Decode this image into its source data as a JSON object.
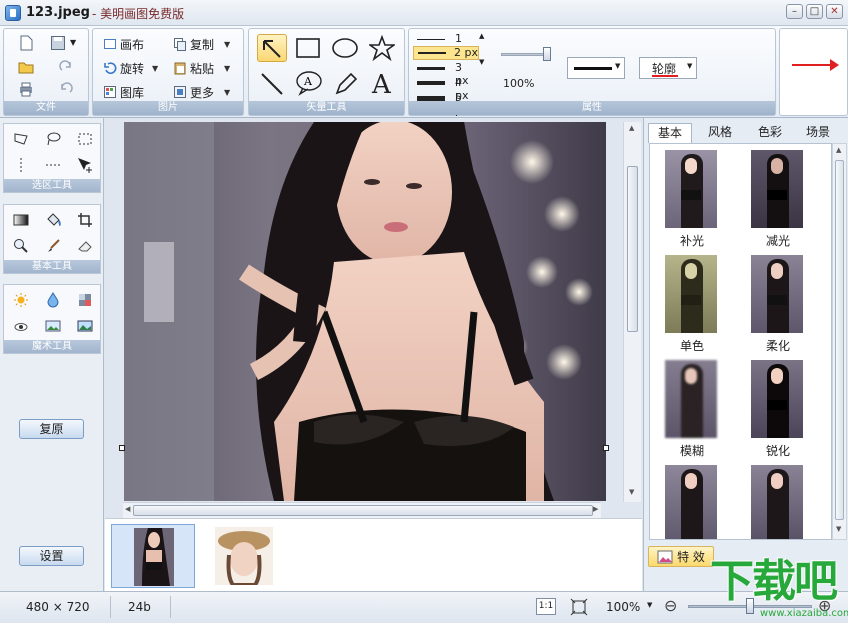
{
  "window": {
    "file_name": "123.jpeg",
    "app_title": "- 美明画图免费版",
    "buttons": {
      "minimize": "–",
      "maximize": "□",
      "close": "✕"
    }
  },
  "ribbon": {
    "file_group": {
      "label": "文件"
    },
    "image_group": {
      "label": "图片",
      "canvas": "画布",
      "copy": "复制",
      "rotate": "旋转",
      "paste": "粘贴",
      "library": "图库",
      "more": "更多"
    },
    "vector_group": {
      "label": "矢量工具"
    },
    "properties_group": {
      "label": "属性",
      "line_widths": [
        "1 px",
        "2 px",
        "3 px",
        "4 px",
        "5 px"
      ],
      "selected_width_index": 1,
      "opacity": "100%",
      "opacity_level": 1.0,
      "outline_label": "轮廓",
      "accent_color": "#e02020"
    }
  },
  "left_panel": {
    "selection_tools_label": "选区工具",
    "basic_tools_label": "基本工具",
    "effect_tools_label": "魔术工具",
    "restore_button": "复原",
    "settings_button": "设置"
  },
  "right_panel": {
    "tabs": [
      "基本",
      "风格",
      "色彩",
      "场景"
    ],
    "active_tab_index": 0,
    "effects": [
      "补光",
      "减光",
      "单色",
      "柔化",
      "模糊",
      "锐化"
    ],
    "fx_button": "特 效"
  },
  "status": {
    "dimensions": "480 × 720",
    "bit_depth": "24b",
    "actual_size": "1:1",
    "zoom": "100%",
    "zoom_out": "⊖",
    "zoom_in": "⊕"
  },
  "watermark": {
    "logo": "下载吧",
    "url": "www.xiazaiba.com"
  }
}
